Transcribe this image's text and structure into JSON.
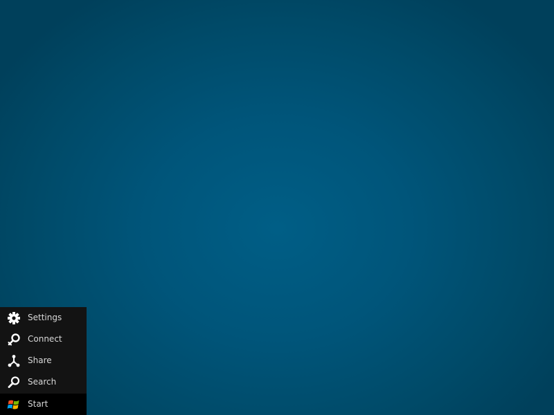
{
  "desktop": {
    "background_color": "#00587e"
  },
  "charms": {
    "items": [
      {
        "label": "Settings",
        "icon": "gear-icon"
      },
      {
        "label": "Connect",
        "icon": "connect-icon"
      },
      {
        "label": "Share",
        "icon": "share-icon"
      },
      {
        "label": "Search",
        "icon": "search-icon"
      },
      {
        "label": "Start",
        "icon": "windows-logo-icon"
      }
    ],
    "panel_color": "#131313",
    "start_color": "#000000",
    "text_color": "#d9d9d9"
  }
}
